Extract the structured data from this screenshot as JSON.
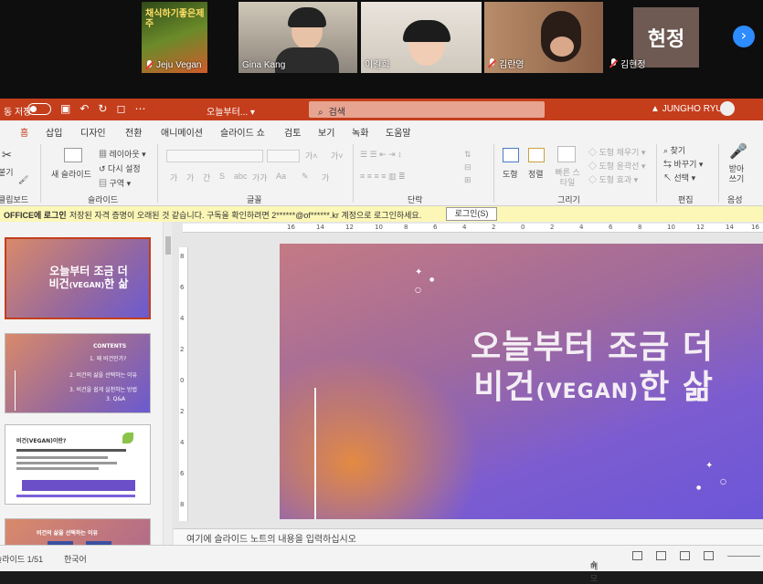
{
  "zoom": {
    "participants": [
      {
        "name": "Jeju Vegan",
        "muted": true,
        "poster_text": "채식하기좋은제주"
      },
      {
        "name": "Gina Kang",
        "muted": false
      },
      {
        "name": "이길희",
        "muted": false
      },
      {
        "name": "김란영",
        "muted": true
      },
      {
        "name": "김현정",
        "muted": true,
        "avatar_text": "현정"
      }
    ],
    "next_icon": "chevron-right-icon"
  },
  "titlebar": {
    "autosave_label": "동 저장",
    "doc_title": "오늘부터...",
    "search_placeholder": "검색",
    "user_name": "JUNGHO RYU",
    "accent": "#c43e1c"
  },
  "ribbon": {
    "tabs": [
      "홈",
      "삽입",
      "디자인",
      "전환",
      "애니메이션",
      "슬라이드 쇼",
      "검토",
      "보기",
      "녹화",
      "도움말"
    ],
    "active_tab": "홈",
    "clipboard": {
      "paste": "붙기",
      "label": "클립보드"
    },
    "slides": {
      "new_slide": "새 슬라이드",
      "layout": "레이아웃",
      "reset": "다시 설정",
      "section": "구역",
      "label": "슬라이드"
    },
    "font": {
      "label": "글꼴",
      "buttons": [
        "가",
        "가",
        "간",
        "S",
        "abc",
        "가가",
        "Aa",
        "가"
      ]
    },
    "paragraph": {
      "label": "단락"
    },
    "drawing": {
      "shape": "도형",
      "arrange": "정렬",
      "quick_style": "빠른 스타일",
      "fill": "도형 채우기",
      "outline": "도형 윤곽선",
      "effect": "도형 효과",
      "label": "그리기"
    },
    "editing": {
      "find": "찾기",
      "replace": "바꾸기",
      "select": "선택",
      "label": "편집"
    },
    "voice": {
      "dictate": "받아쓰기",
      "label": "음성"
    }
  },
  "message_bar": {
    "label": "OFFICE에 로그인",
    "text": "저장된 자격 증명이 오래된 것 같습니다. 구독을 확인하려면 2******@of******.kr 계정으로 로그인하세요.",
    "button": "로그인(S)"
  },
  "thumbnails": [
    {
      "number": "1",
      "title_line1": "오늘부터 조금 더",
      "title_line2_a": "비건",
      "title_line2_en": "(VEGAN)",
      "title_line2_b": "한 삶"
    },
    {
      "number": "2",
      "heading": "CONTENTS",
      "items": [
        "1. 왜 비건인가?",
        "2. 비건의 삶을 선택하는 이유",
        "3. 비건을 쉽게 실천하는 방법",
        "3. Q&A"
      ]
    },
    {
      "number": "3",
      "heading": "비건(VEGAN)이란?"
    },
    {
      "number": "4",
      "heading": "비건의 삶을 선택하는 이유"
    }
  ],
  "rulers": {
    "horizontal": [
      "16",
      "14",
      "12",
      "10",
      "8",
      "6",
      "4",
      "2",
      "0",
      "2",
      "4",
      "6",
      "8",
      "10",
      "12",
      "14",
      "16"
    ],
    "vertical": [
      "8",
      "6",
      "4",
      "2",
      "0",
      "2",
      "4",
      "6",
      "8"
    ]
  },
  "slide": {
    "title_line1": "오늘부터 조금 더",
    "title_line2_a": "비건",
    "title_line2_en": "(VEGAN)",
    "title_line2_b": "한 삶",
    "colors": {
      "gradient_start": "#c47a84",
      "gradient_end": "#6c56d8",
      "glow": "#e88c3c"
    }
  },
  "notes_placeholder": "여기에 슬라이드 노트의 내용을 입력하십시오",
  "status": {
    "slide_counter": "슬라이드 1/51",
    "language": "한국어",
    "notes": "메모"
  }
}
